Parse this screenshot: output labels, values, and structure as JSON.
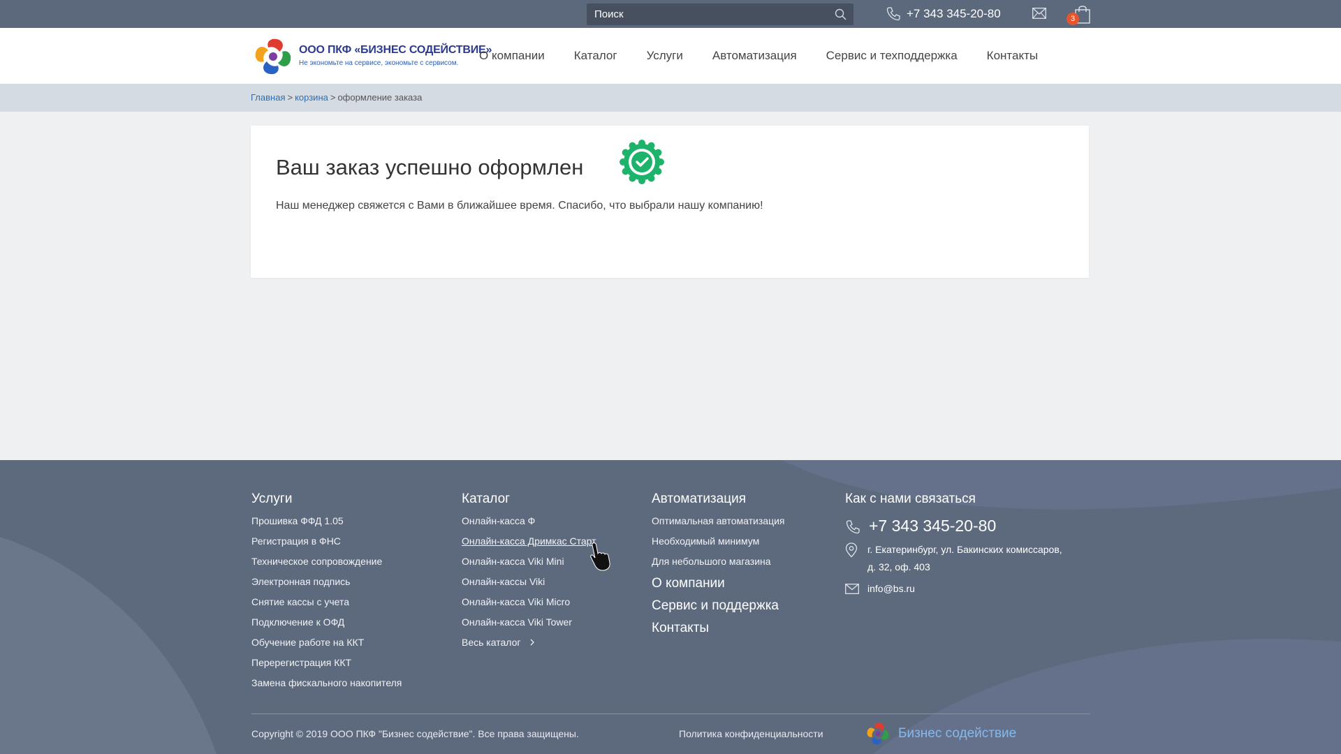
{
  "topbar": {
    "search_placeholder": "Поиск",
    "phone": "+7 343 345-20-80",
    "cart_count": "3"
  },
  "header": {
    "logo_title": "ООО ПКФ «БИЗНЕС СОДЕЙСТВИЕ»",
    "logo_tagline": "Не экономьте на сервисе, экономьте с сервисом.",
    "nav": [
      "О компании",
      "Каталог",
      "Услуги",
      "Автоматизация",
      "Сервис и техподдержка",
      "Контакты"
    ]
  },
  "breadcrumb": {
    "home": "Главная",
    "cart": "корзина",
    "current": "оформление заказа"
  },
  "confirmation": {
    "title": "Ваш заказ успешно оформлен",
    "message": "Наш менеджер свяжется с Вами в ближайшее время. Спасибо, что выбрали нашу компанию!"
  },
  "footer": {
    "services": {
      "title": "Услуги",
      "items": [
        "Прошивка ФФД 1.05",
        "Регистрация в ФНС",
        "Техническое сопровождение",
        "Электронная подпись",
        "Снятие кассы с учета",
        "Подключение к ОФД",
        "Обучение работе на ККТ",
        "Перерегистрация ККТ",
        "Замена фискального накопителя"
      ]
    },
    "catalog": {
      "title": "Каталог",
      "items": [
        "Онлайн-касса Ф",
        "Онлайн-касса Дримкас Старт",
        "Онлайн-касса Viki Mini",
        "Онлайн-кассы Viki",
        "Онлайн-касса Viki Micro",
        "Онлайн-касса Viki Tower",
        "Весь каталог"
      ]
    },
    "automation": {
      "title": "Автоматизация",
      "items": [
        "Оптимальная автоматизация",
        "Необходимый минимум",
        "Для небольшого магазина"
      ],
      "links": [
        "О компании",
        "Сервис и поддержка",
        "Контакты"
      ]
    },
    "contacts": {
      "title": "Как с нами связаться",
      "phone": "+7 343 345-20-80",
      "address_line1": "г. Екатеринбург, ул. Бакинских комиссаров,",
      "address_line2": "д. 32, оф. 403",
      "email": "info@bs.ru"
    },
    "copyright": "Copyright © 2019 ООО ПКФ \"Бизнес содействие\". Все права защищены.",
    "policy": "Политика конфиденциальности",
    "brand": "Бизнес содействие"
  },
  "colors": {
    "topbar": "#5c687c",
    "footer": "#5d6a7e",
    "accent_green": "#1db36a",
    "link_blue": "#2b6fb3",
    "badge_orange": "#e8552b"
  },
  "icons": [
    "search-icon",
    "phone-icon",
    "mail-icon",
    "cart-icon",
    "check-badge-icon",
    "location-icon",
    "chevron-right-icon",
    "hand-cursor-icon"
  ]
}
